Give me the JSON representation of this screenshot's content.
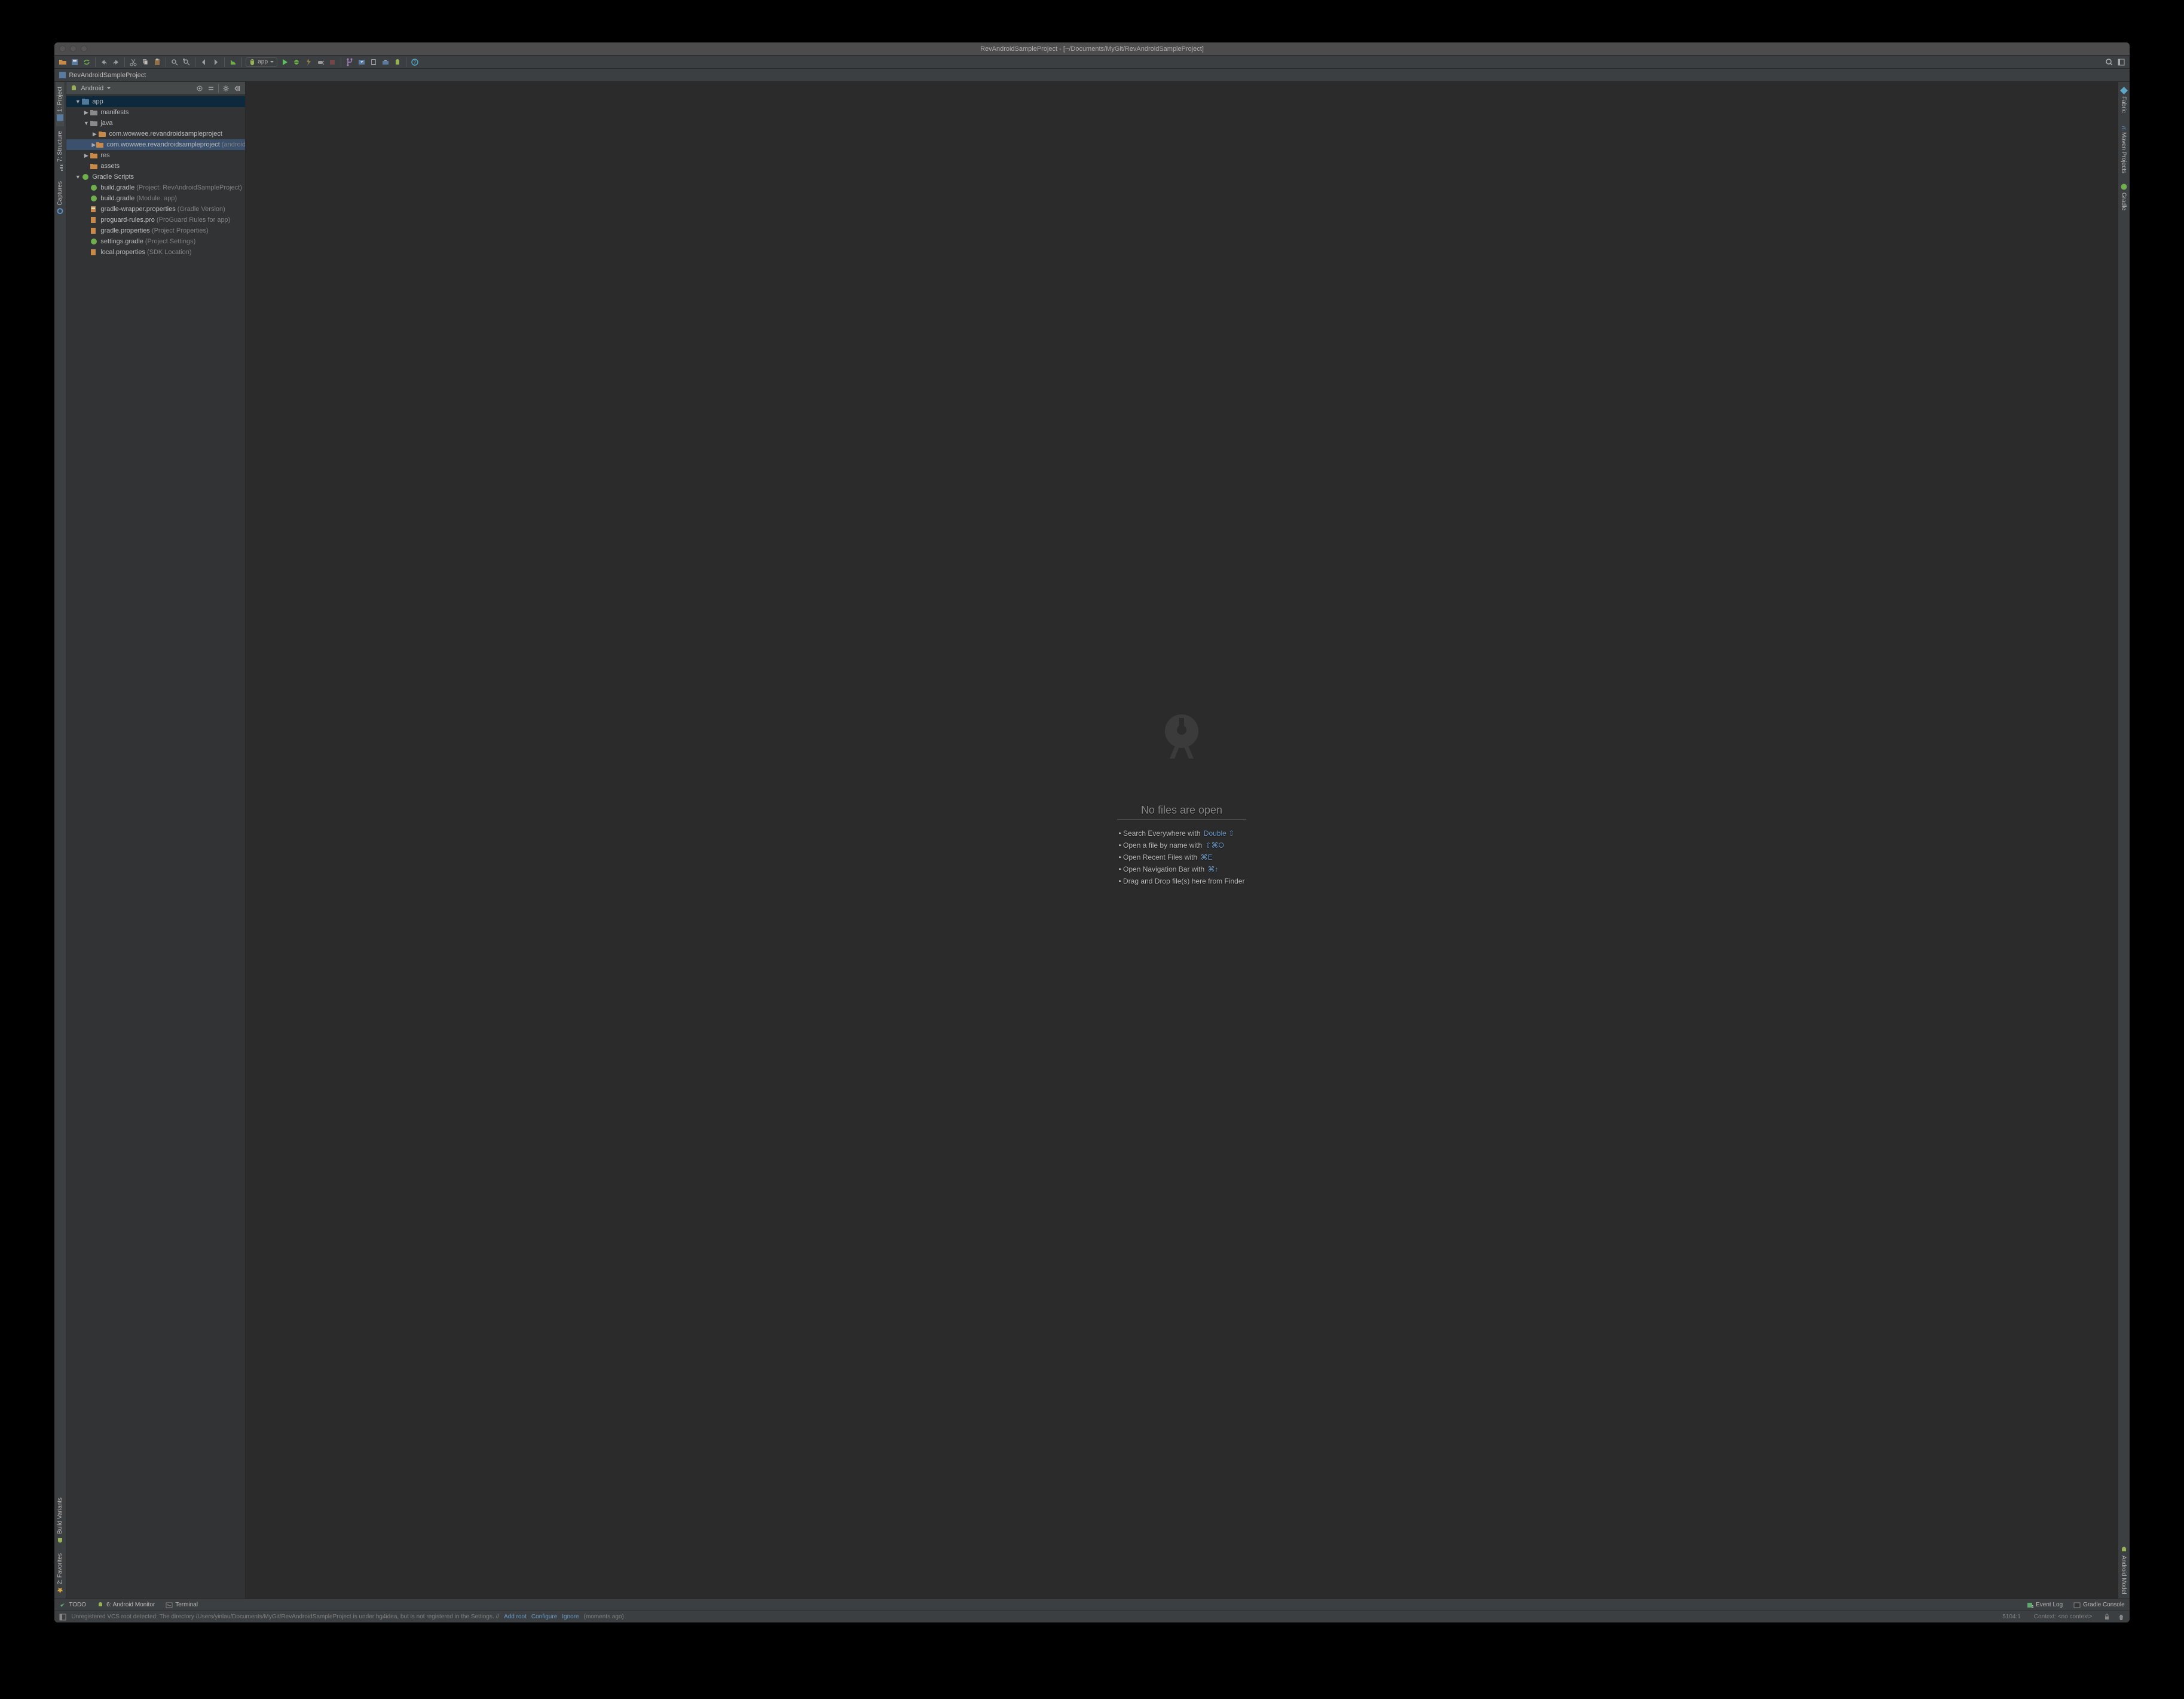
{
  "title": "RevAndroidSampleProject - [~/Documents/MyGit/RevAndroidSampleProject]",
  "breadcrumb": {
    "root": "RevAndroidSampleProject"
  },
  "toolbar": {
    "app_label": "app"
  },
  "side_head": {
    "view": "Android"
  },
  "left_tabs": {
    "project": "1: Project",
    "structure": "7: Structure",
    "captures": "Captures",
    "build_variants": "Build Variants",
    "favorites": "2: Favorites"
  },
  "right_tabs": {
    "fabric": "Fabric",
    "maven": "Maven Projects",
    "gradle": "Gradle",
    "android_model": "Android Model"
  },
  "tree": {
    "app": "app",
    "manifests": "manifests",
    "java": "java",
    "pkg": "com.wowwee.revandroidsampleproject",
    "pkg_test": "com.wowwee.revandroidsampleproject",
    "pkg_test_sfx": "(androidTest)",
    "res": "res",
    "assets": "assets",
    "gradle_scripts": "Gradle Scripts",
    "build_gradle_proj": "build.gradle",
    "build_gradle_proj_sfx": "(Project: RevAndroidSampleProject)",
    "build_gradle_app": "build.gradle",
    "build_gradle_app_sfx": "(Module: app)",
    "wrapper": "gradle-wrapper.properties",
    "wrapper_sfx": "(Gradle Version)",
    "proguard": "proguard-rules.pro",
    "proguard_sfx": "(ProGuard Rules for app)",
    "gradle_props": "gradle.properties",
    "gradle_props_sfx": "(Project Properties)",
    "settings": "settings.gradle",
    "settings_sfx": "(Project Settings)",
    "local": "local.properties",
    "local_sfx": "(SDK Location)"
  },
  "editor": {
    "heading": "No files are open",
    "tips": [
      {
        "text": "Search Everywhere with",
        "kbd": "Double ⇧"
      },
      {
        "text": "Open a file by name with",
        "kbd": "⇧⌘O"
      },
      {
        "text": "Open Recent Files with",
        "kbd": "⌘E"
      },
      {
        "text": "Open Navigation Bar with",
        "kbd": "⌘↑"
      },
      {
        "text": "Drag and Drop file(s) here from Finder",
        "kbd": ""
      }
    ]
  },
  "bottom": {
    "todo": "TODO",
    "monitor": "6: Android Monitor",
    "terminal": "Terminal",
    "event_log": "Event Log",
    "gradle_console": "Gradle Console"
  },
  "status": {
    "msg_pre": "Unregistered VCS root detected: The directory /Users/yinlau/Documents/MyGit/RevAndroidSampleProject is under hg4idea, but is not registered in the Settings. //",
    "add_root": "Add root",
    "configure": "Configure",
    "ignore": "Ignore",
    "moments": "(moments ago)",
    "linecol": "5104:1",
    "context": "Context: <no context>"
  }
}
